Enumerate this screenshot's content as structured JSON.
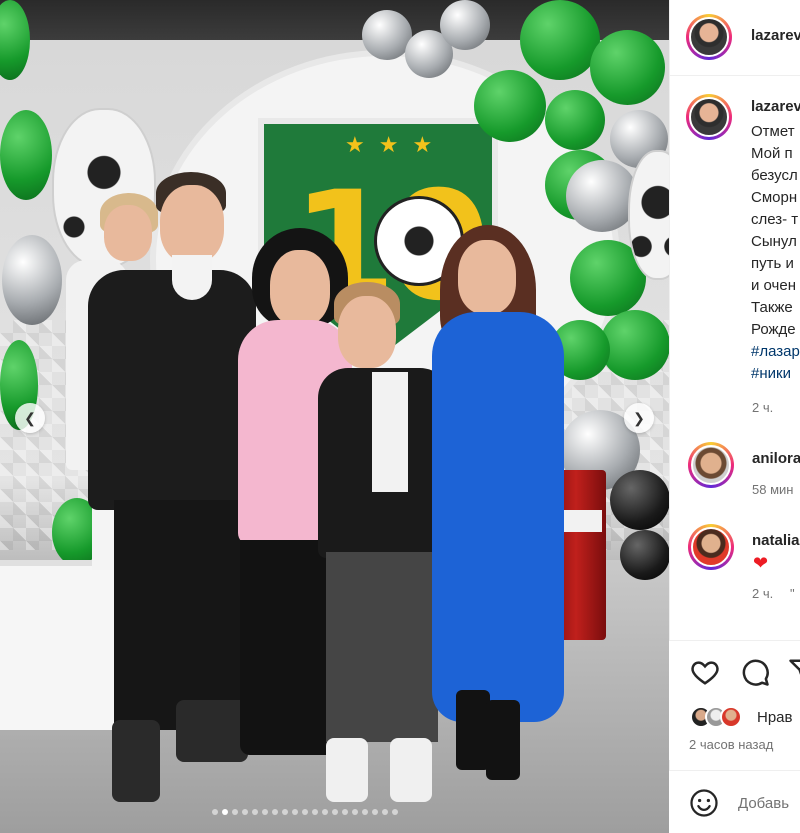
{
  "post": {
    "author": "lazarev",
    "photo_dots": {
      "total": 19,
      "active": 1
    }
  },
  "caption": {
    "author": "lazarev",
    "lines": [
      "Отмет",
      "Мой п",
      "безусл",
      "Сморн",
      "слез- т",
      "Сынул",
      "путь и",
      "и очен",
      "Также",
      "Рожде"
    ],
    "hashtags": [
      "#лазар",
      "#ники"
    ],
    "time": "2 ч."
  },
  "comments": [
    {
      "author": "anilora",
      "time": "58 мин"
    },
    {
      "author": "natalia",
      "emoji": "❤",
      "time": "2 ч.",
      "reply": "\""
    }
  ],
  "likes": {
    "text": "Нрав"
  },
  "timestamp": "2 часов назад",
  "comment_box": {
    "placeholder": "Добавь"
  },
  "icons": {
    "like": "heart-icon",
    "comment": "comment-icon",
    "share": "share-icon",
    "emoji": "emoji-icon",
    "prev": "chevron-left-icon",
    "next": "chevron-right-icon"
  },
  "colors": {
    "hashtag": "#00376b",
    "heart": "#ed1c24",
    "meta": "#737373"
  }
}
